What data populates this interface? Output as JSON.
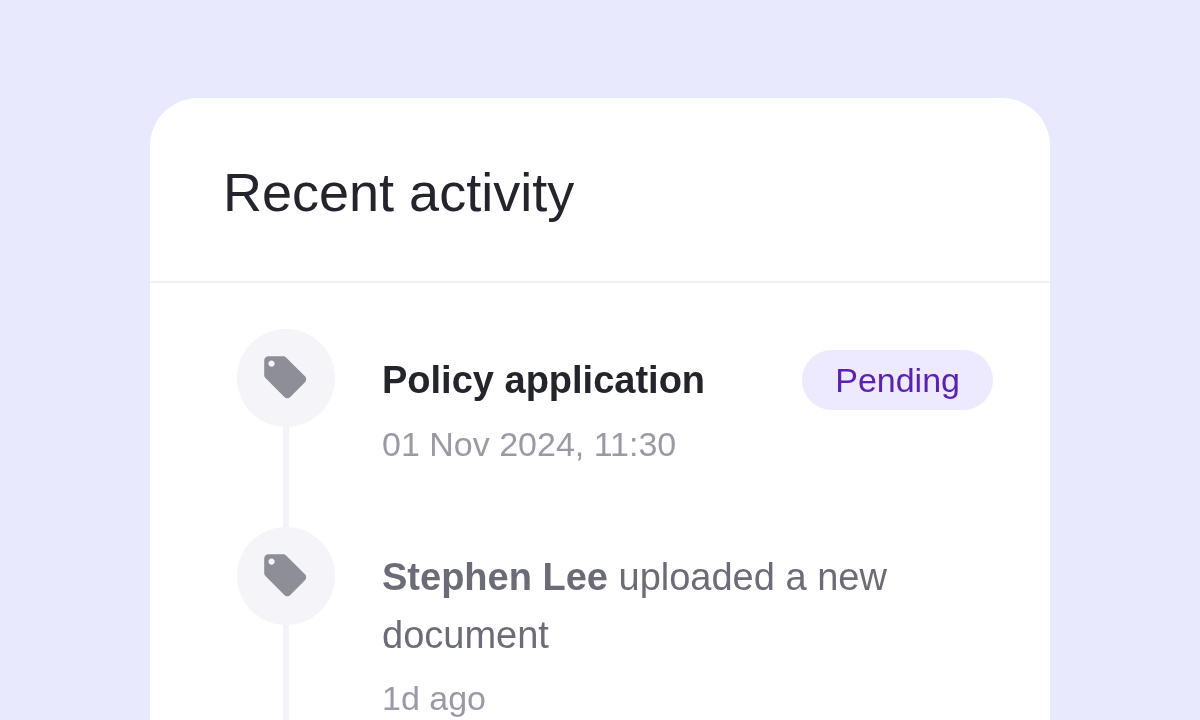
{
  "card": {
    "title": "Recent activity",
    "activities": [
      {
        "kind": "status",
        "title": "Policy application",
        "status": "Pending",
        "time": "01 Nov 2024, 11:30"
      },
      {
        "kind": "action",
        "text": "**Stephen Lee** uploaded a new document",
        "time": "1d ago"
      }
    ]
  }
}
